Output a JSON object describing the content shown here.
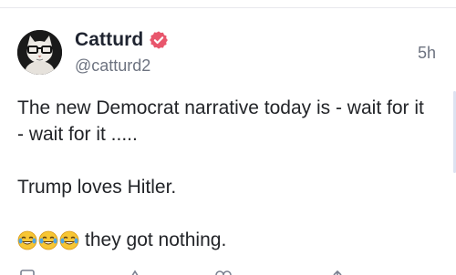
{
  "post": {
    "author": {
      "display_name": "Catturd",
      "handle": "@catturd2",
      "verified": true,
      "avatar_icon": "cat-with-glasses-avatar"
    },
    "timestamp": "5h",
    "body": {
      "line1": "The new Democrat narrative today is - wait for it - wait for it .....",
      "line2": "Trump loves Hitler.",
      "emojis": [
        "face-with-tears-of-joy",
        "face-with-tears-of-joy",
        "face-with-tears-of-joy"
      ],
      "line3": "they got nothing."
    },
    "actions": [
      "reply-icon",
      "repost-icon",
      "like-icon",
      "share-icon"
    ]
  },
  "colors": {
    "verified_badge": "#e8566c",
    "secondary_text": "#6d7380",
    "primary_text": "#222428"
  }
}
